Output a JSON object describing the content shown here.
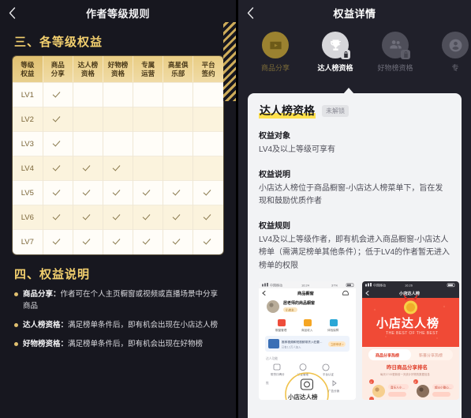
{
  "left": {
    "nav": {
      "back_icon": "chevron-left-icon",
      "title": "作者等级规则"
    },
    "section3_title": "三、各等级权益",
    "table": {
      "headers": [
        "等级\n权益",
        "商品\n分享",
        "达人榜\n资格",
        "好物榜\n资格",
        "专属\n运营",
        "高星俱\n乐部",
        "平台\n签约"
      ],
      "headers_flat": [
        "等级权益",
        "商品分享",
        "达人榜资格",
        "好物榜资格",
        "专属运营",
        "高星俱乐部",
        "平台签约"
      ],
      "rows": [
        {
          "level": "LV1",
          "marks": [
            true,
            false,
            false,
            false,
            false,
            false
          ]
        },
        {
          "level": "LV2",
          "marks": [
            true,
            false,
            false,
            false,
            false,
            false
          ]
        },
        {
          "level": "LV3",
          "marks": [
            true,
            false,
            false,
            false,
            false,
            false
          ]
        },
        {
          "level": "LV4",
          "marks": [
            true,
            true,
            true,
            false,
            false,
            false
          ]
        },
        {
          "level": "LV5",
          "marks": [
            true,
            true,
            true,
            true,
            true,
            true
          ]
        },
        {
          "level": "LV6",
          "marks": [
            true,
            true,
            true,
            true,
            true,
            true
          ]
        },
        {
          "level": "LV7",
          "marks": [
            true,
            true,
            true,
            true,
            true,
            true
          ]
        }
      ]
    },
    "section4_title": "四、权益说明",
    "notes": [
      {
        "term": "商品分享：",
        "text": "作者可在个人主页橱窗或视频或直播场景中分享商品"
      },
      {
        "term": "达人榜资格：",
        "text": "满足榜单条件后，即有机会出现在小店达人榜"
      },
      {
        "term": "好物榜资格：",
        "text": "满足榜单条件后，即有机会出现在好物榜"
      }
    ]
  },
  "right": {
    "nav": {
      "back_icon": "chevron-left-icon",
      "title": "权益详情"
    },
    "icons": [
      {
        "label": "商品分享",
        "icon": "video-play-icon",
        "state": "unlocked-dim",
        "locked": false
      },
      {
        "label": "达人榜资格",
        "icon": "trophy-icon",
        "state": "selected",
        "locked": true
      },
      {
        "label": "好物榜资格",
        "icon": "people-icon",
        "state": "dim",
        "locked": true
      },
      {
        "label": "专",
        "icon": "operation-icon",
        "state": "dim",
        "locked": false
      }
    ],
    "card": {
      "title": "达人榜资格",
      "badge": "未解锁",
      "blocks": [
        {
          "heading": "权益对象",
          "body": "LV4及以上等级可享有"
        },
        {
          "heading": "权益说明",
          "body": "小店达人榜位于商品橱窗-小店达人榜菜单下，旨在发现和鼓励优质作者"
        },
        {
          "heading": "权益规则",
          "body": "LV4及以上等级作者，即有机会进入商品橱窗-小店达人榜单（需满足榜单其他条件）；低于LV4的作者暂无进入榜单的权限"
        }
      ],
      "screenshots": [
        {
          "name": "shop-window-screenshot",
          "status_carrier": "中国移动",
          "status_time": "16:24",
          "status_batt": "37%",
          "title": "商品橱窗",
          "profile_name": "居老师的商品橱窗",
          "profile_tag": "小店主",
          "menu": [
            "橱窗管理",
            "商品收入",
            "体验保障"
          ],
          "banner_text": "推荐视频和短视频带货入驻要求…",
          "banner_cta": "立即申请"
        },
        {
          "name": "daren-leaderboard-screenshot",
          "status_carrier": "中国移动",
          "status_time": "16:26",
          "title": "小店达人榜",
          "hero_title": "小店达人榜",
          "hero_sub": "THE BEST OF THE BEST",
          "tabs": [
            "商品分享热榜",
            "新晋分享热榜"
          ],
          "list_title": "昨日商品分享排名",
          "list_sub": "每天17:00更新前一天统计好物的数据"
        }
      ],
      "highlight_label": "小店达人榜"
    }
  },
  "colors": {
    "bg_dark": "#17171f",
    "bg_dark2": "#20202a",
    "gold": "#f2cf6e",
    "table_header": "#e9cd84",
    "card_bg": "#f2f3f5",
    "highlight_yellow": "#ffe14d",
    "red_hero": "#f04a36"
  }
}
